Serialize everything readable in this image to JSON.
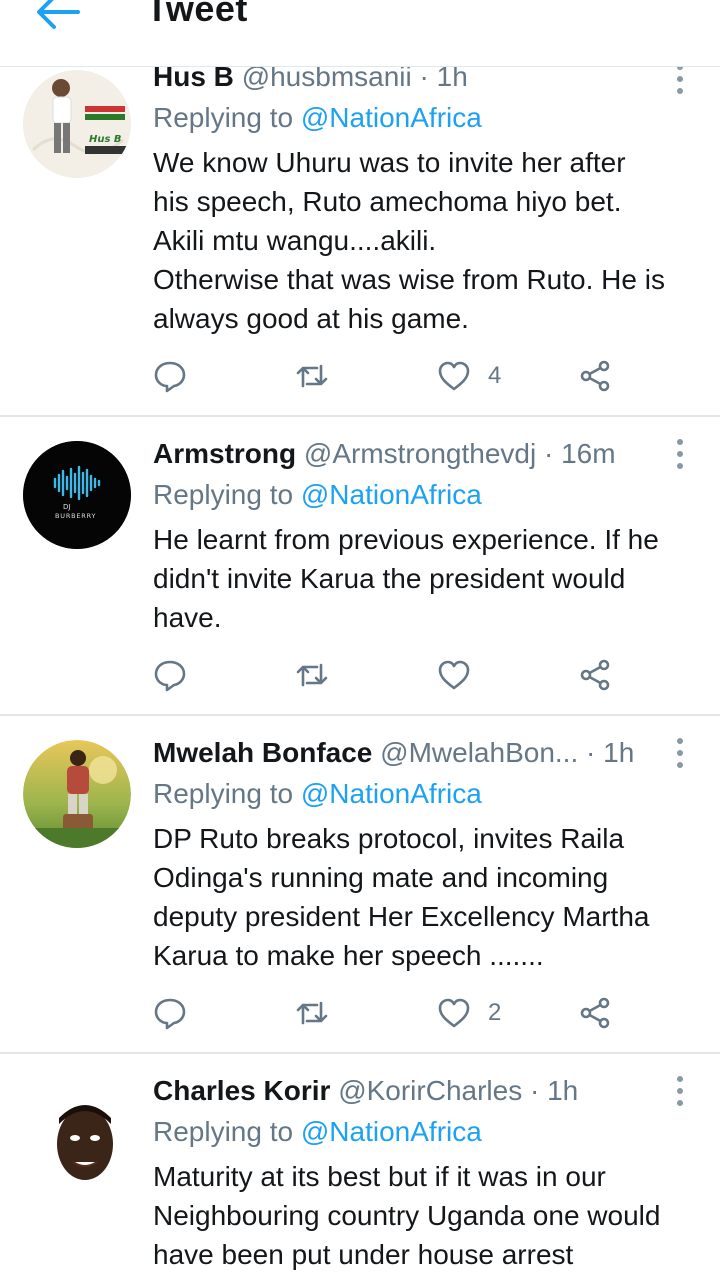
{
  "header": {
    "title": "Tweet"
  },
  "tweets": [
    {
      "name": "Hus B",
      "handle": "@husbmsanii",
      "time": "1h",
      "replying_prefix": "Replying to",
      "replying_to": "@NationAfrica",
      "text": "We know Uhuru was to invite her after\nhis speech, Ruto amechoma hiyo bet.\nAkili mtu wangu....akili.\nOtherwise that was wise from Ruto. He is\nalways good at his game.",
      "likes": "4",
      "avatar_text": "Hus B"
    },
    {
      "name": "Armstrong",
      "handle": "@Armstrongthevdj",
      "time": "16m",
      "replying_prefix": "Replying to",
      "replying_to": "@NationAfrica",
      "text": "He learnt from previous experience. If he\ndidn't invite Karua the president would\nhave.",
      "likes": "",
      "avatar_text": "DJ\nBURBERRY"
    },
    {
      "name": "Mwelah Bonface",
      "handle": "@MwelahBon...",
      "time": "1h",
      "replying_prefix": "Replying to",
      "replying_to": "@NationAfrica",
      "text": "DP Ruto breaks protocol, invites Raila\nOdinga's running mate and incoming\ndeputy president Her Excellency Martha\nKarua to make her speech .......",
      "likes": "2"
    },
    {
      "name": "Charles Korir",
      "handle": "@KorirCharles",
      "time": "1h",
      "replying_prefix": "Replying to",
      "replying_to": "@NationAfrica",
      "text": "Maturity at its best but if it was in our\nNeighbouring country Uganda one would\nhave been put  under house arrest"
    }
  ],
  "colors": {
    "accent": "#1da1f2",
    "secondary_text": "#657786",
    "icon": "#657786"
  }
}
